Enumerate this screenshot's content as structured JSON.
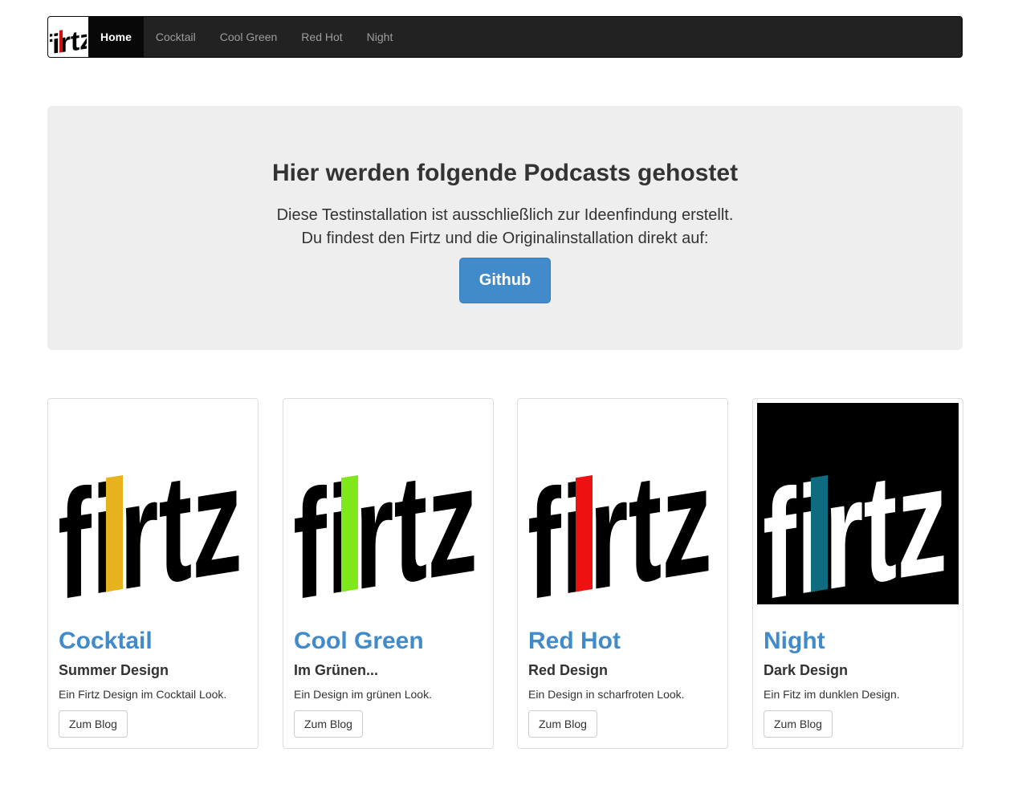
{
  "nav": {
    "brand": "firtz",
    "items": [
      {
        "label": "Home",
        "active": true
      },
      {
        "label": "Cocktail",
        "active": false
      },
      {
        "label": "Cool Green",
        "active": false
      },
      {
        "label": "Red Hot",
        "active": false
      },
      {
        "label": "Night",
        "active": false
      }
    ]
  },
  "jumbotron": {
    "heading": "Hier werden folgende Podcasts gehostet",
    "lead_line1": "Diese Testinstallation ist ausschließlich zur Ideenfindung erstellt.",
    "lead_line2": "Du findest den Firtz und die Originalinstallation direkt auf:",
    "button": "Github"
  },
  "cards": [
    {
      "logo_text": "firtz",
      "accent": "#e6b31e",
      "background": "#ffffff",
      "letters": "#000000",
      "title": "Cocktail",
      "subtitle": "Summer Design",
      "description": "Ein Firtz Design im Cocktail Look.",
      "button": "Zum Blog"
    },
    {
      "logo_text": "firtz",
      "accent": "#7fe81c",
      "background": "#ffffff",
      "letters": "#000000",
      "title": "Cool Green",
      "subtitle": "Im Grünen...",
      "description": "Ein Design im grünen Look.",
      "button": "Zum Blog"
    },
    {
      "logo_text": "firtz",
      "accent": "#ee1111",
      "background": "#ffffff",
      "letters": "#000000",
      "title": "Red Hot",
      "subtitle": "Red Design",
      "description": "Ein Design in scharfroten Look.",
      "button": "Zum Blog"
    },
    {
      "logo_text": "firtz",
      "accent": "#0e6b80",
      "background": "#000000",
      "letters": "#ffffff",
      "title": "Night",
      "subtitle": "Dark Design",
      "description": "Ein Fitz im dunklen Design.",
      "button": "Zum Blog"
    }
  ]
}
